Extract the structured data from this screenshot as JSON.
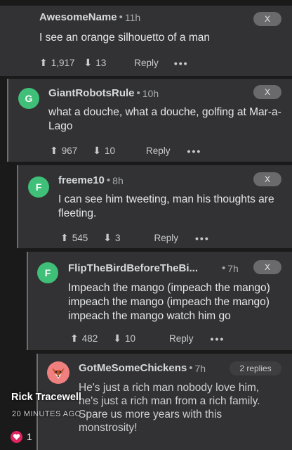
{
  "comments": [
    {
      "username": "AwesomeName",
      "age": "11h",
      "text": "I see an orange silhouetto of a man",
      "upvotes": "1,917",
      "downvotes": "13",
      "reply_label": "Reply",
      "close_label": "X",
      "avatar_letter": ""
    },
    {
      "username": "GiantRobotsRule",
      "age": "10h",
      "text": "what a douche, what a douche, golfing at Mar-a-Lago",
      "upvotes": "967",
      "downvotes": "10",
      "reply_label": "Reply",
      "close_label": "X",
      "avatar_letter": "G"
    },
    {
      "username": "freeme10",
      "age": "8h",
      "text": "I can see him tweeting, man his thoughts are fleeting.",
      "upvotes": "545",
      "downvotes": "3",
      "reply_label": "Reply",
      "close_label": "X",
      "avatar_letter": "F"
    },
    {
      "username": "FlipTheBirdBeforeTheBi...",
      "age": "7h",
      "text": "Impeach the mango (impeach the mango) impeach the mango (impeach the mango) impeach the mango watch him go",
      "upvotes": "482",
      "downvotes": "10",
      "reply_label": "Reply",
      "close_label": "X",
      "avatar_letter": "F"
    },
    {
      "username": "GotMeSomeChickens",
      "age": "7h",
      "text": "He's just a rich man nobody love him, he's just a rich man from a rich family. Spare us more years with this monstrosity!",
      "replies_label": "2 replies"
    }
  ],
  "overlay": {
    "poster_name": "Rick Tracewell",
    "posted_time": "20 MINUTES AGO",
    "like_count": "1"
  },
  "colors": {
    "background": "#1a1a1b",
    "card": "#323234",
    "avatar_green": "#3fbf78",
    "like_red": "#e0245e"
  }
}
